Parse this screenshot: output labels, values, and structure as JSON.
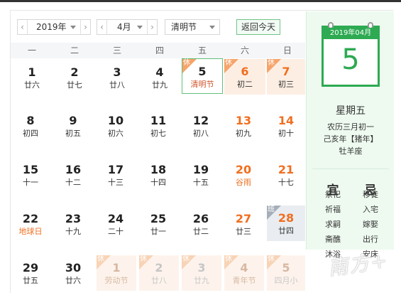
{
  "toolbar": {
    "year_value": "2019年",
    "month_value": "4月",
    "holiday_value": "清明节",
    "today_label": "返回今天"
  },
  "weekdays": [
    "一",
    "二",
    "三",
    "四",
    "五",
    "六",
    "日"
  ],
  "rows": [
    [
      {
        "num": "1",
        "lunar": "廿六"
      },
      {
        "num": "2",
        "lunar": "廿七"
      },
      {
        "num": "3",
        "lunar": "廿八"
      },
      {
        "num": "4",
        "lunar": "廿九"
      },
      {
        "num": "5",
        "lunar": "清明节",
        "tag": "休"
      },
      {
        "num": "6",
        "lunar": "初二",
        "tag": "休"
      },
      {
        "num": "7",
        "lunar": "初三",
        "tag": "休"
      }
    ],
    [
      {
        "num": "8",
        "lunar": "初四"
      },
      {
        "num": "9",
        "lunar": "初五"
      },
      {
        "num": "10",
        "lunar": "初六"
      },
      {
        "num": "11",
        "lunar": "初七"
      },
      {
        "num": "12",
        "lunar": "初八"
      },
      {
        "num": "13",
        "lunar": "初九"
      },
      {
        "num": "14",
        "lunar": "初十"
      }
    ],
    [
      {
        "num": "15",
        "lunar": "十一"
      },
      {
        "num": "16",
        "lunar": "十二"
      },
      {
        "num": "17",
        "lunar": "十三"
      },
      {
        "num": "18",
        "lunar": "十四"
      },
      {
        "num": "19",
        "lunar": "十五"
      },
      {
        "num": "20",
        "lunar": "谷雨"
      },
      {
        "num": "21",
        "lunar": "十七"
      }
    ],
    [
      {
        "num": "22",
        "lunar": "地球日"
      },
      {
        "num": "23",
        "lunar": "十九"
      },
      {
        "num": "24",
        "lunar": "二十"
      },
      {
        "num": "25",
        "lunar": "廿一"
      },
      {
        "num": "26",
        "lunar": "廿二"
      },
      {
        "num": "27",
        "lunar": "廿三"
      },
      {
        "num": "28",
        "lunar": "廿四",
        "tag": "班"
      }
    ],
    [
      {
        "num": "29",
        "lunar": "廿五"
      },
      {
        "num": "30",
        "lunar": "廿六"
      },
      {
        "num": "1",
        "lunar": "劳动节",
        "tag": "休"
      },
      {
        "num": "2",
        "lunar": "廿八",
        "tag": "休"
      },
      {
        "num": "3",
        "lunar": "廿九",
        "tag": "休"
      },
      {
        "num": "4",
        "lunar": "青年节",
        "tag": "休"
      },
      {
        "num": "5",
        "lunar": "四月小",
        "tag": "休"
      }
    ]
  ],
  "panel": {
    "card_header": "2019年04月",
    "card_day": "5",
    "weekday": "星期五",
    "lunar_date": "农历三月初一",
    "ganzhi": "己亥年【猪年】",
    "zodiac": "牡羊座",
    "yi_label": "宜",
    "ji_label": "忌",
    "yi_items": [
      "祭祀",
      "祈福",
      "求嗣",
      "斋醮",
      "沐浴"
    ],
    "ji_items": [
      "移徙",
      "入宅",
      "嫁娶",
      "出行",
      "安床"
    ]
  },
  "watermark": "南方+",
  "colors": {
    "accent_green": "#2daa52",
    "holiday_orange": "#f06f20",
    "holiday_bg": "#fdeee3"
  }
}
